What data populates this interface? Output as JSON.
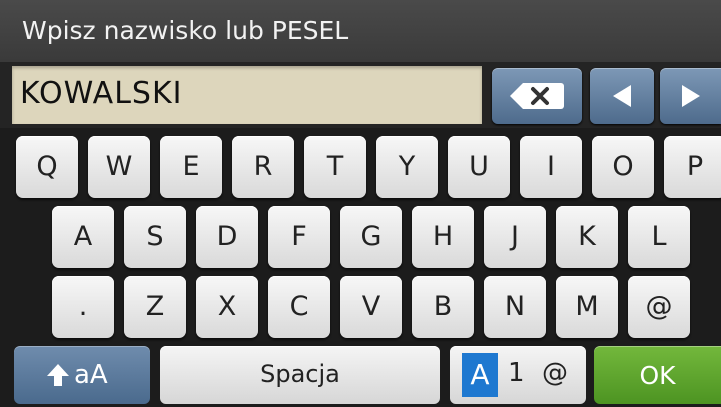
{
  "header": {
    "title": "Wpisz nazwisko lub PESEL"
  },
  "input": {
    "value": "KOWALSKI"
  },
  "keyboard": {
    "row1": [
      "Q",
      "W",
      "E",
      "R",
      "T",
      "Y",
      "U",
      "I",
      "O",
      "P"
    ],
    "row2": [
      "A",
      "S",
      "D",
      "F",
      "G",
      "H",
      "J",
      "K",
      "L"
    ],
    "row3": [
      ".",
      "Z",
      "X",
      "C",
      "V",
      "B",
      "N",
      "M",
      "@"
    ]
  },
  "bottom": {
    "shift_label": "aA",
    "space_label": "Spacja",
    "mode_alpha": "A",
    "mode_num": "1",
    "mode_sym": "@",
    "ok_label": "OK"
  },
  "colors": {
    "accent_blue": "#5f7fa3",
    "ok_green": "#5aa12b",
    "field_bg": "#ddd6bc"
  },
  "icons": {
    "backspace": "backspace-icon",
    "left": "arrow-left-icon",
    "right": "arrow-right-icon",
    "shift": "shift-arrow-icon"
  }
}
